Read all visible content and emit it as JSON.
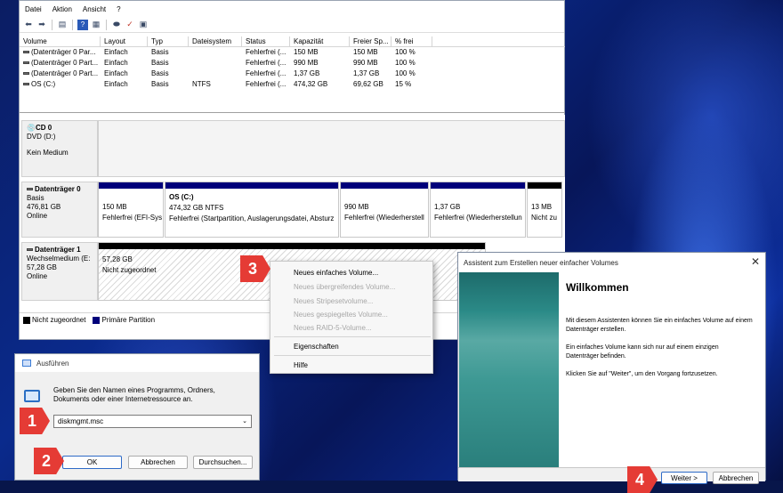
{
  "disk_management": {
    "menu": [
      "Datei",
      "Aktion",
      "Ansicht",
      "?"
    ],
    "toolbar_icons": [
      "back-arrow-icon",
      "forward-arrow-icon",
      "console-tree-icon",
      "help-icon",
      "properties-icon",
      "disk-icon",
      "check-icon",
      "view-icon"
    ],
    "columns": [
      "Volume",
      "Layout",
      "Typ",
      "Dateisystem",
      "Status",
      "Kapazität",
      "Freier Sp...",
      "% frei"
    ],
    "rows": [
      [
        "(Datenträger 0 Par...",
        "Einfach",
        "Basis",
        "",
        "Fehlerfrei (...",
        "150 MB",
        "150 MB",
        "100 %"
      ],
      [
        "(Datenträger 0 Part...",
        "Einfach",
        "Basis",
        "",
        "Fehlerfrei (...",
        "990 MB",
        "990 MB",
        "100 %"
      ],
      [
        "(Datenträger 0 Part...",
        "Einfach",
        "Basis",
        "",
        "Fehlerfrei (...",
        "1,37 GB",
        "1,37 GB",
        "100 %"
      ],
      [
        "OS (C:)",
        "Einfach",
        "Basis",
        "NTFS",
        "Fehlerfrei (...",
        "474,32 GB",
        "69,62 GB",
        "15 %"
      ]
    ],
    "cd0": {
      "name": "CD 0",
      "type": "DVD (D:)",
      "status": "Kein Medium"
    },
    "disk0": {
      "name": "Datenträger 0",
      "type": "Basis",
      "size": "476,81 GB",
      "status": "Online",
      "partitions": [
        {
          "title": "",
          "size": "150 MB",
          "status": "Fehlerfrei (EFI-Sys"
        },
        {
          "title": "OS  (C:)",
          "size": "474,32 GB NTFS",
          "status": "Fehlerfrei (Startpartition, Auslagerungsdatei, Absturz"
        },
        {
          "title": "",
          "size": "990 MB",
          "status": "Fehlerfrei (Wiederherstell"
        },
        {
          "title": "",
          "size": "1,37 GB",
          "status": "Fehlerfrei (Wiederherstellun"
        },
        {
          "title": "",
          "size": "13 MB",
          "status": "Nicht zu"
        }
      ]
    },
    "disk1": {
      "name": "Datenträger 1",
      "type": "Wechselmedium (E:",
      "size": "57,28 GB",
      "status": "Online",
      "partition": {
        "size": "57,28 GB",
        "status": "Nicht zugeordnet"
      }
    },
    "legend": {
      "unallocated": "Nicht zugeordnet",
      "primary": "Primäre Partition"
    }
  },
  "context_menu": {
    "items": [
      "Neues einfaches Volume...",
      "Neues übergreifendes Volume...",
      "Neues Stripesetvolume...",
      "Neues gespiegeltes Volume...",
      "Neues RAID-5-Volume...",
      "Eigenschaften",
      "Hilfe"
    ]
  },
  "run_dialog": {
    "title": "Ausführen",
    "description": "Geben Sie den Namen eines Programms, Ordners, Dokuments oder einer Internetressource an.",
    "input_value": "diskmgmt.msc",
    "ok": "OK",
    "cancel": "Abbrechen",
    "browse": "Durchsuchen..."
  },
  "wizard": {
    "title": "Assistent zum Erstellen neuer einfacher Volumes",
    "heading": "Willkommen",
    "p1": "Mit diesem Assistenten können Sie ein einfaches Volume auf einem Datenträger erstellen.",
    "p2": "Ein einfaches Volume kann sich nur auf einem einzigen Datenträger befinden.",
    "p3": "Klicken Sie auf \"Weiter\", um den Vorgang fortzusetzen.",
    "next": "Weiter >",
    "cancel": "Abbrechen"
  },
  "steps": [
    "1",
    "2",
    "3",
    "4"
  ],
  "colors": {
    "primary_partition": "#00007a",
    "unallocated": "#000000",
    "step_badge": "#e53b35",
    "wizard_side": "#2b8a87"
  }
}
